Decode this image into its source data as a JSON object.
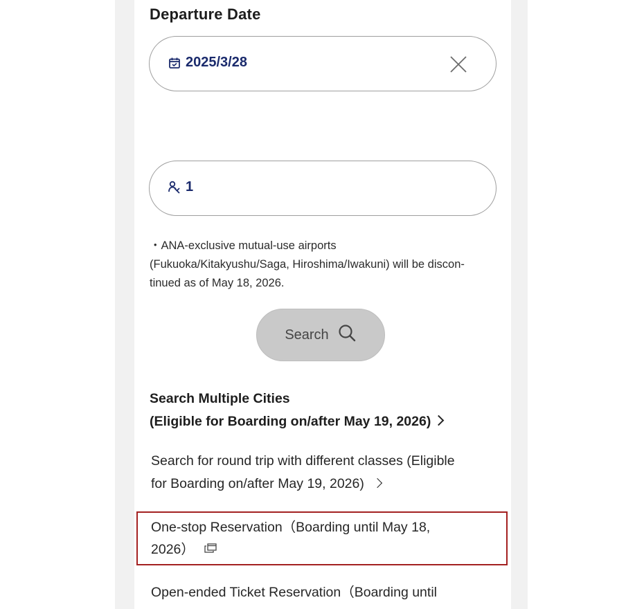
{
  "departure": {
    "title": "Departure Date",
    "date_value": "2025/3/28"
  },
  "passengers": {
    "count": "1"
  },
  "notice": {
    "text": "・ANA-exclusive mutual-use airports (Fukuoka/Kitakyushu/Saga, Hiroshima/Iwakuni) will be discon-tinued as of May 18, 2026.",
    "line1": "・ANA-exclusive mutual-use airports",
    "line2": "(Fukuoka/Kitakyushu/Saga, Hiroshima/Iwakuni) will be discon-",
    "line3": "tinued as of May 18, 2026."
  },
  "search_button": {
    "label": "Search"
  },
  "links": {
    "multi_cities_line1": "Search Multiple Cities",
    "multi_cities_line2": "(Eligible for Boarding on/after May 19, 2026)",
    "roundtrip_line1": "Search for round trip with different classes (Eligible",
    "roundtrip_line2": "for Boarding on/after May 19, 2026)",
    "onestop_line1": "One-stop Reservation（Boarding until May 18,",
    "onestop_line2": "2026）",
    "openended_line1": "Open-ended Ticket Reservation（Boarding until"
  },
  "colors": {
    "accent_navy": "#1a2a6c",
    "highlight_red": "#a32020",
    "button_gray": "#c9c9c9"
  },
  "icons": {
    "date": "calendar-icon",
    "clear": "close-icon",
    "passenger": "passenger-icon",
    "search": "search-icon",
    "external": "external-window-icon"
  }
}
